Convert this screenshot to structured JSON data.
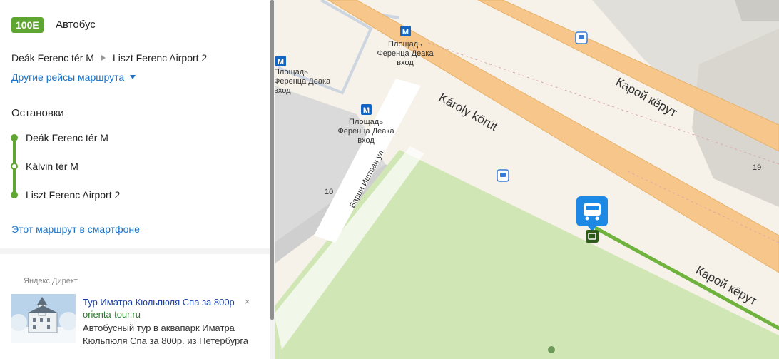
{
  "route": {
    "number": "100E",
    "type": "Автобус"
  },
  "direction": {
    "from": "Deák Ferenc tér M",
    "to": "Liszt Ferenc Airport 2"
  },
  "other_trips_label": "Другие рейсы маршрута",
  "stops_title": "Остановки",
  "stops": [
    "Deák Ferenc tér M",
    "Kálvin tér M",
    "Liszt Ferenc Airport 2"
  ],
  "phone_link": "Этот маршрут в смартфоне",
  "ad": {
    "label": "Яндекс.Директ",
    "title": "Тур Иматра Кюльпюля Спа за 800р",
    "close": "×",
    "url": "orienta-tour.ru",
    "text": "Автобусный тур в аквапарк Иматра Кюльпюля Спа за 800р. из Петербурга"
  },
  "map": {
    "labels": {
      "metro_exit_1": "Площадь Ференца Деака вход",
      "metro_exit_2": "Площадь Ференца Деака вход",
      "metro_exit_3": "Площадь Ференца Деака вход",
      "karoly_korut_1": "Károly körút",
      "karoy_keryt_1": "Карой кёрут",
      "karoy_keryt_2": "Карой кёрут",
      "bajcsy_street": "Барци Иштван ул.",
      "house_10": "10",
      "house_19": "19"
    },
    "metro_icon": "М",
    "colors": {
      "route": "#6fb33e",
      "road": "#f7c68a",
      "park": "#d0e6b5",
      "land": "#f6f2e9",
      "stop": "#1e88e5"
    }
  }
}
